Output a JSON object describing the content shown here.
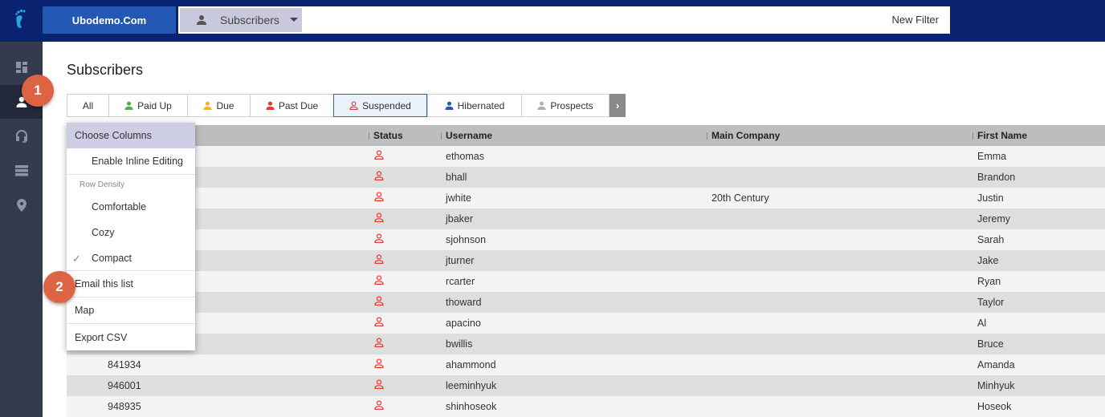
{
  "topbar": {
    "org_name": "Ubodemo.Com",
    "entity_select": "Subscribers",
    "new_filter": "New Filter",
    "colors": {
      "bar": "#0a2370",
      "org_button": "#2458b5",
      "logo": "#29a8e0"
    }
  },
  "sidebar": {
    "items": [
      {
        "icon": "dashboard-icon"
      },
      {
        "icon": "person-icon",
        "active": true
      },
      {
        "icon": "headset-icon"
      },
      {
        "icon": "list-icon"
      },
      {
        "icon": "location-pin-icon"
      }
    ]
  },
  "badges": {
    "one": "1",
    "two": "2",
    "color": "#dd6443"
  },
  "page": {
    "title": "Subscribers"
  },
  "tabs": [
    {
      "label": "All",
      "icon": null,
      "color": null
    },
    {
      "label": "Paid Up",
      "icon": "person-icon",
      "color": "#4caf50"
    },
    {
      "label": "Due",
      "icon": "person-icon",
      "color": "#f5b42a"
    },
    {
      "label": "Past Due",
      "icon": "person-icon",
      "color": "#e53935"
    },
    {
      "label": "Suspended",
      "icon": "person-outline-icon",
      "color": "#e53935",
      "selected": true
    },
    {
      "label": "Hibernated",
      "icon": "person-icon",
      "color": "#2458b5"
    },
    {
      "label": "Prospects",
      "icon": "person-icon",
      "color": "#b0b0b0"
    }
  ],
  "menu": {
    "choose_columns": "Choose Columns",
    "inline_editing": "Enable Inline Editing",
    "row_density_label": "Row Density",
    "density": {
      "comfortable": "Comfortable",
      "cozy": "Cozy",
      "compact": "Compact",
      "selected": "Compact"
    },
    "email_list": "Email this list",
    "map": "Map",
    "export_csv": "Export CSV"
  },
  "grid": {
    "columns": {
      "status": "Status",
      "username": "Username",
      "company": "Main Company",
      "first_name": "First Name"
    },
    "status_color": "#e53935",
    "rows": [
      {
        "id": "",
        "username": "ethomas",
        "company": "",
        "first_name": "Emma"
      },
      {
        "id": "",
        "username": "bhall",
        "company": "",
        "first_name": "Brandon"
      },
      {
        "id": "",
        "username": "jwhite",
        "company": "20th Century",
        "first_name": "Justin"
      },
      {
        "id": "",
        "username": "jbaker",
        "company": "",
        "first_name": "Jeremy"
      },
      {
        "id": "",
        "username": "sjohnson",
        "company": "",
        "first_name": "Sarah"
      },
      {
        "id": "",
        "username": "jturner",
        "company": "",
        "first_name": "Jake"
      },
      {
        "id": "",
        "username": "rcarter",
        "company": "",
        "first_name": "Ryan"
      },
      {
        "id": "",
        "username": "thoward",
        "company": "",
        "first_name": "Taylor"
      },
      {
        "id": "",
        "username": "apacino",
        "company": "",
        "first_name": "Al"
      },
      {
        "id": "",
        "username": "bwillis",
        "company": "",
        "first_name": "Bruce"
      },
      {
        "id": "841934",
        "username": "ahammond",
        "company": "",
        "first_name": "Amanda"
      },
      {
        "id": "946001",
        "username": "leeminhyuk",
        "company": "",
        "first_name": "Minhyuk"
      },
      {
        "id": "948935",
        "username": "shinhoseok",
        "company": "",
        "first_name": "Hoseok"
      }
    ]
  }
}
